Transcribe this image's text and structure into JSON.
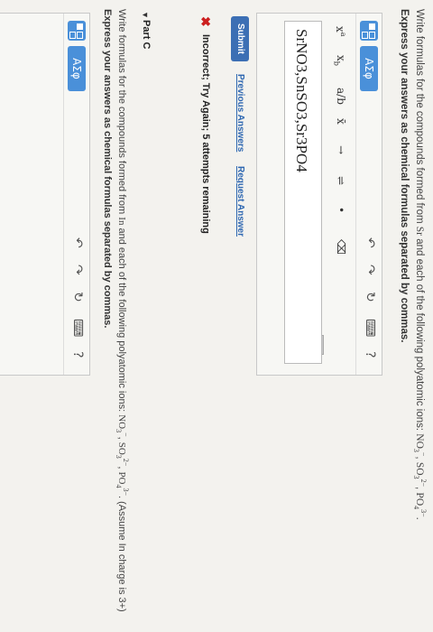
{
  "part_b": {
    "question_prefix": "Write formulas for the compounds formed from",
    "element": "Sr",
    "question_middle": "and each of the following polyatomic ions:",
    "ions": [
      {
        "base": "NO",
        "sub": "3",
        "charge": "−"
      },
      {
        "base": "SO",
        "sub": "3",
        "charge": "2−"
      },
      {
        "base": "PO",
        "sub": "4",
        "charge": "3−"
      }
    ],
    "instruction": "Express your answers as chemical formulas separated by commas.",
    "toolbar": {
      "greek_label": "ΑΣφ",
      "undo": "↶",
      "redo": "↷",
      "reset": "↻",
      "keyboard": "⌨",
      "help": "?"
    },
    "symbols": {
      "superscript": "x",
      "superscript_exp": "a",
      "subscript": "x",
      "subscript_sub": "b",
      "fraction": "a/b",
      "overline": "x̄",
      "arrow": "→",
      "equilibrium": "⇌",
      "dot": "•",
      "delete": "⌫",
      "keyboard_label": "⌨"
    },
    "answer_value": "SrNO3,SnSO3,Sr3PO4",
    "submit_label": "Submit",
    "previous_answers_label": "Previous Answers",
    "request_answer_label": "Request Answer",
    "feedback": "Incorrect; Try Again; 5 attempts remaining"
  },
  "part_c": {
    "label": "Part C",
    "question_prefix": "Write formulas for the compounds formed from",
    "element": "In",
    "question_middle": "and each of the following polyatomic ions:",
    "suffix": ". (Assume In charge is 3+)",
    "instruction": "Express your answers as chemical formulas separated by commas.",
    "toolbar": {
      "greek_label": "ΑΣφ",
      "undo": "↶",
      "redo": "↷",
      "reset": "↻",
      "keyboard": "⌨",
      "help": "?"
    }
  },
  "colors": {
    "accent": "#4a90d9",
    "submit": "#3c6fb4",
    "link": "#2e67b1",
    "error": "#cc1f1f"
  }
}
